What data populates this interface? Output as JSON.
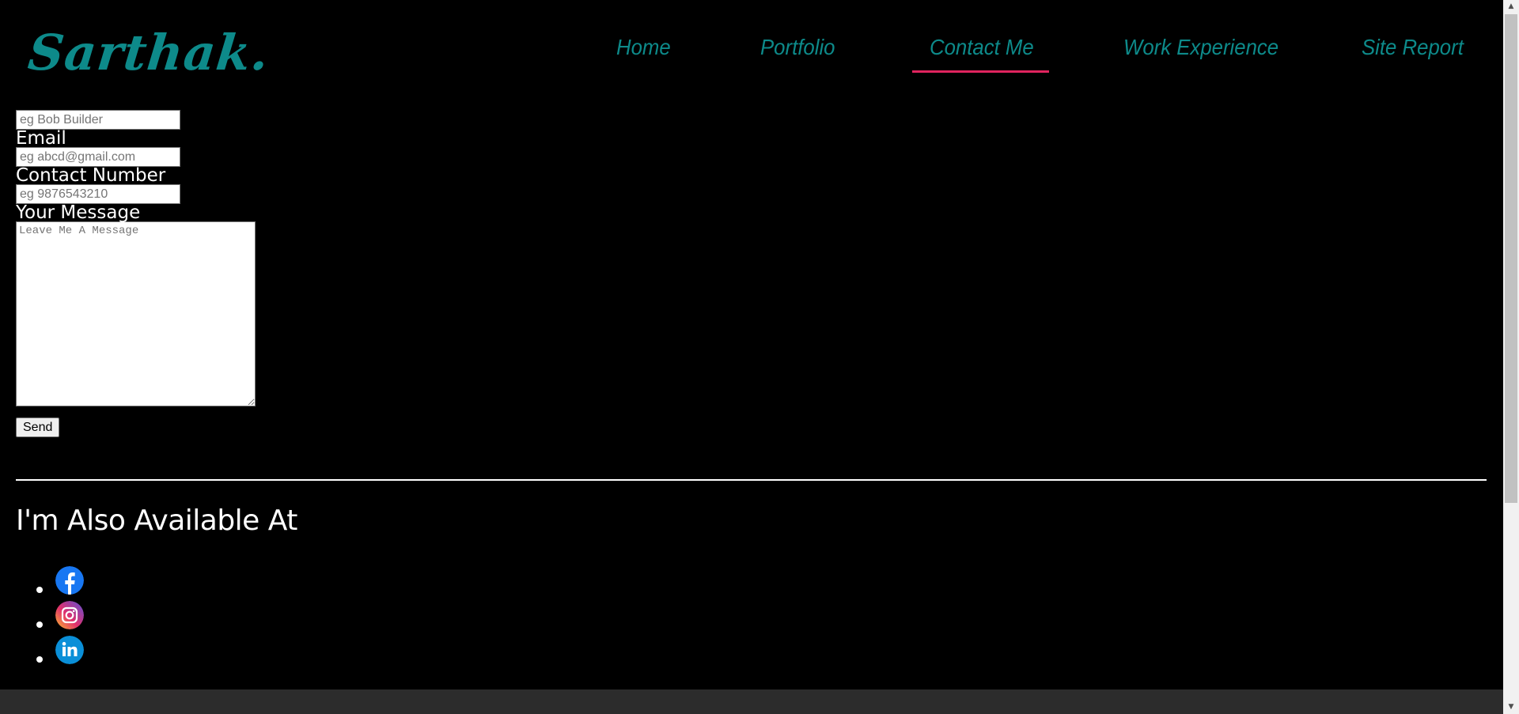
{
  "header": {
    "logo": "Sarthak.",
    "nav": [
      {
        "label": "Home",
        "active": false
      },
      {
        "label": "Portfolio",
        "active": false
      },
      {
        "label": "Contact Me",
        "active": true
      },
      {
        "label": "Work Experience",
        "active": false
      },
      {
        "label": "Site Report",
        "active": false
      }
    ]
  },
  "form": {
    "name": {
      "placeholder": "eg Bob Builder",
      "value": ""
    },
    "email": {
      "label": "Email",
      "placeholder": "eg abcd@gmail.com",
      "value": ""
    },
    "contact": {
      "label": "Contact Number",
      "placeholder": "eg 9876543210",
      "value": ""
    },
    "message": {
      "label": "Your Message",
      "placeholder": "Leave Me A Message",
      "value": ""
    },
    "send_label": "Send"
  },
  "social": {
    "title": "I'm Also Available At",
    "links": [
      {
        "icon": "facebook-icon"
      },
      {
        "icon": "instagram-icon"
      },
      {
        "icon": "linkedin-icon"
      }
    ]
  },
  "colors": {
    "accent": "#0d8a8a",
    "active_underline": "#e0245e",
    "background": "#000000",
    "footer": "#2c2c2c"
  },
  "scrollbar": {
    "up_arrow": "▲",
    "down_arrow": "▼"
  }
}
